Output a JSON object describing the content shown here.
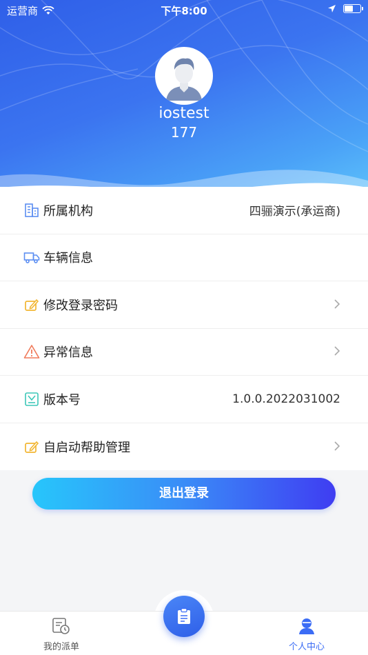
{
  "status_bar": {
    "carrier": "运营商",
    "time": "下午8:00",
    "battery_fraction": 0.55
  },
  "profile": {
    "username": "iostest",
    "user_id": "177"
  },
  "menu": {
    "items": [
      {
        "label": "所属机构",
        "value": "四骊演示(承运商)",
        "icon": "building-icon",
        "color": "#5b8ef2"
      },
      {
        "label": "车辆信息",
        "value": "",
        "icon": "truck-icon",
        "color": "#5b8ef2"
      },
      {
        "label": "修改登录密码",
        "value": "",
        "icon": "edit-icon",
        "color": "#f2b632"
      },
      {
        "label": "异常信息",
        "value": "",
        "icon": "warning-icon",
        "color": "#f07a5a"
      },
      {
        "label": "版本号",
        "value": "1.0.0.2022031002",
        "icon": "version-icon",
        "color": "#3cc7b8"
      },
      {
        "label": "自启动帮助管理",
        "value": "",
        "icon": "edit-icon",
        "color": "#f2b632"
      }
    ]
  },
  "logout_label": "退出登录",
  "tabbar": {
    "left_label": "我的派单",
    "right_label": "个人中心",
    "active_color": "#3b6cf5"
  }
}
